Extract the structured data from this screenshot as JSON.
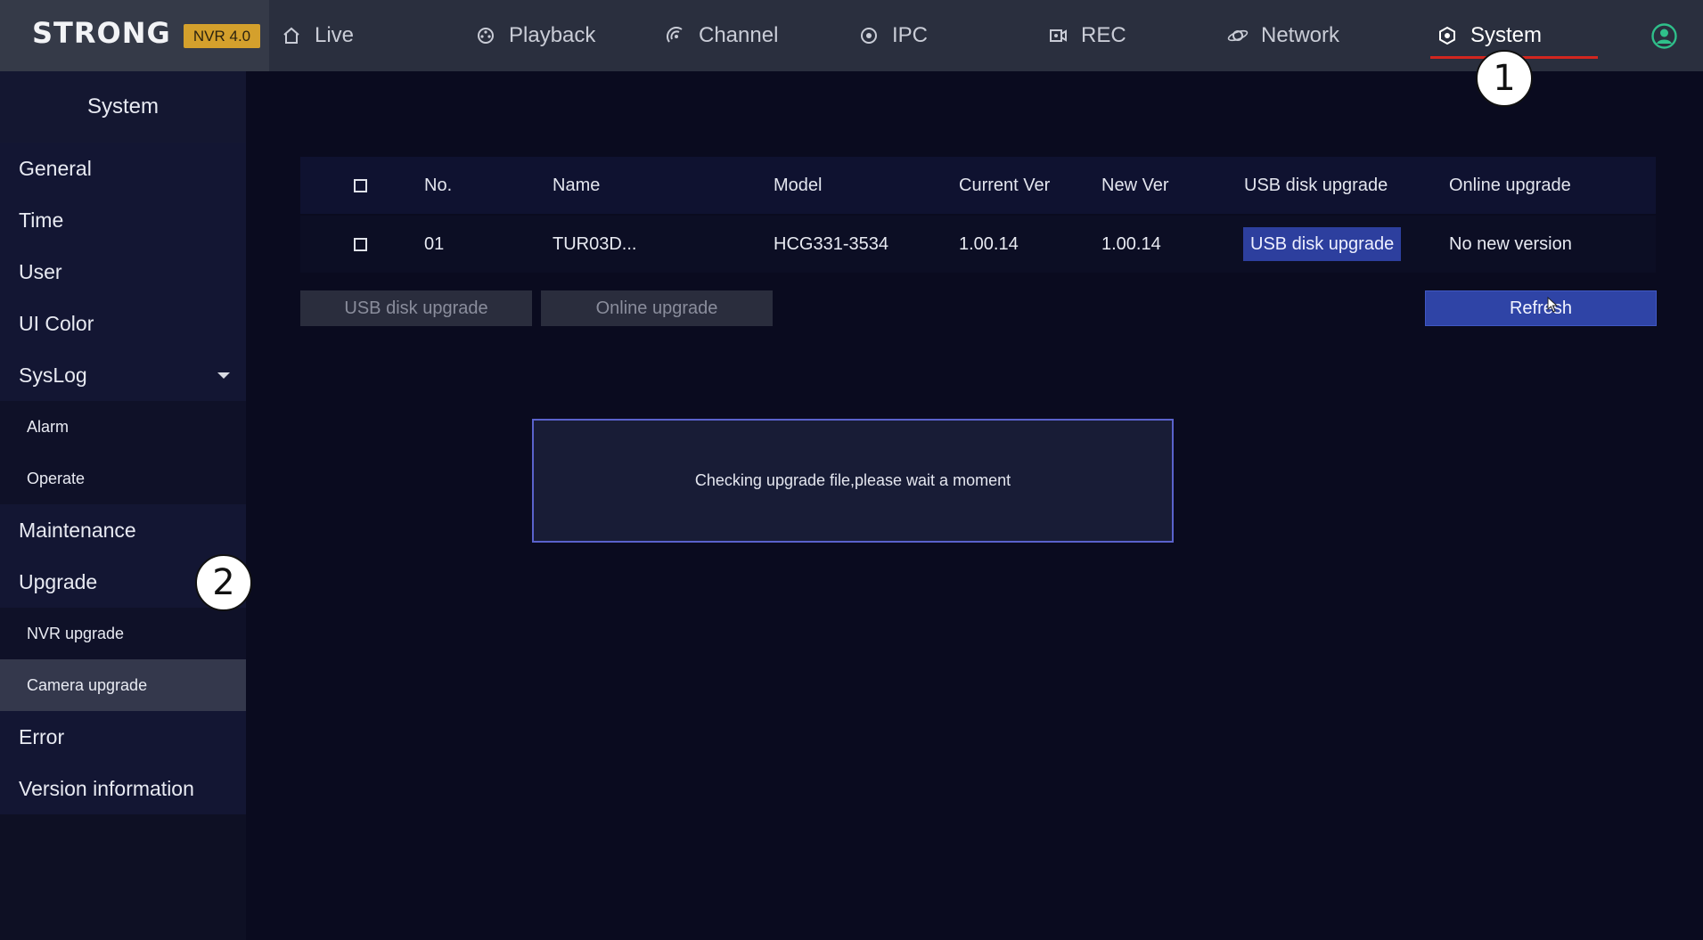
{
  "brand": {
    "logo": "STRONG",
    "badge": "NVR 4.0"
  },
  "nav": [
    {
      "label": "Live",
      "icon": "home-icon"
    },
    {
      "label": "Playback",
      "icon": "playback-icon"
    },
    {
      "label": "Channel",
      "icon": "channel-icon"
    },
    {
      "label": "IPC",
      "icon": "ipc-icon"
    },
    {
      "label": "REC",
      "icon": "rec-icon"
    },
    {
      "label": "Network",
      "icon": "network-icon"
    },
    {
      "label": "System",
      "icon": "system-icon",
      "active": true
    }
  ],
  "sidebar": {
    "title": "System",
    "items": [
      {
        "label": "General"
      },
      {
        "label": "Time"
      },
      {
        "label": "User"
      },
      {
        "label": "UI  Color"
      },
      {
        "label": "SysLog",
        "expandable": true
      },
      {
        "label": "Alarm",
        "sub": true
      },
      {
        "label": "Operate",
        "sub": true
      },
      {
        "label": "Maintenance"
      },
      {
        "label": "Upgrade"
      },
      {
        "label": "NVR  upgrade",
        "sub": true
      },
      {
        "label": "Camera  upgrade",
        "sub": true,
        "selected": true
      },
      {
        "label": "Error"
      },
      {
        "label": "Version  information"
      }
    ]
  },
  "table": {
    "headers": {
      "no": "No.",
      "name": "Name",
      "model": "Model",
      "current_ver": "Current  Ver",
      "new_ver": "New  Ver",
      "usb": "USB  disk  upgrade",
      "online": "Online  upgrade"
    },
    "rows": [
      {
        "no": "01",
        "name": "TUR03D...",
        "model": "HCG331-3534",
        "current_ver": "1.00.14",
        "new_ver": "1.00.14",
        "usb": "USB  disk  upgrade",
        "online": "No  new  version"
      }
    ]
  },
  "buttons": {
    "usb_upgrade": "USB  disk  upgrade",
    "online_upgrade": "Online  upgrade",
    "refresh": "Refresh"
  },
  "dialog": {
    "message": "Checking  upgrade  file,please  wait  a  moment"
  },
  "callouts": {
    "one": "1",
    "two": "2"
  },
  "colors": {
    "accent": "#2f44a6",
    "nav_underline": "#d2261f",
    "badge": "#d4a02c",
    "user_icon": "#2fbf8a"
  }
}
